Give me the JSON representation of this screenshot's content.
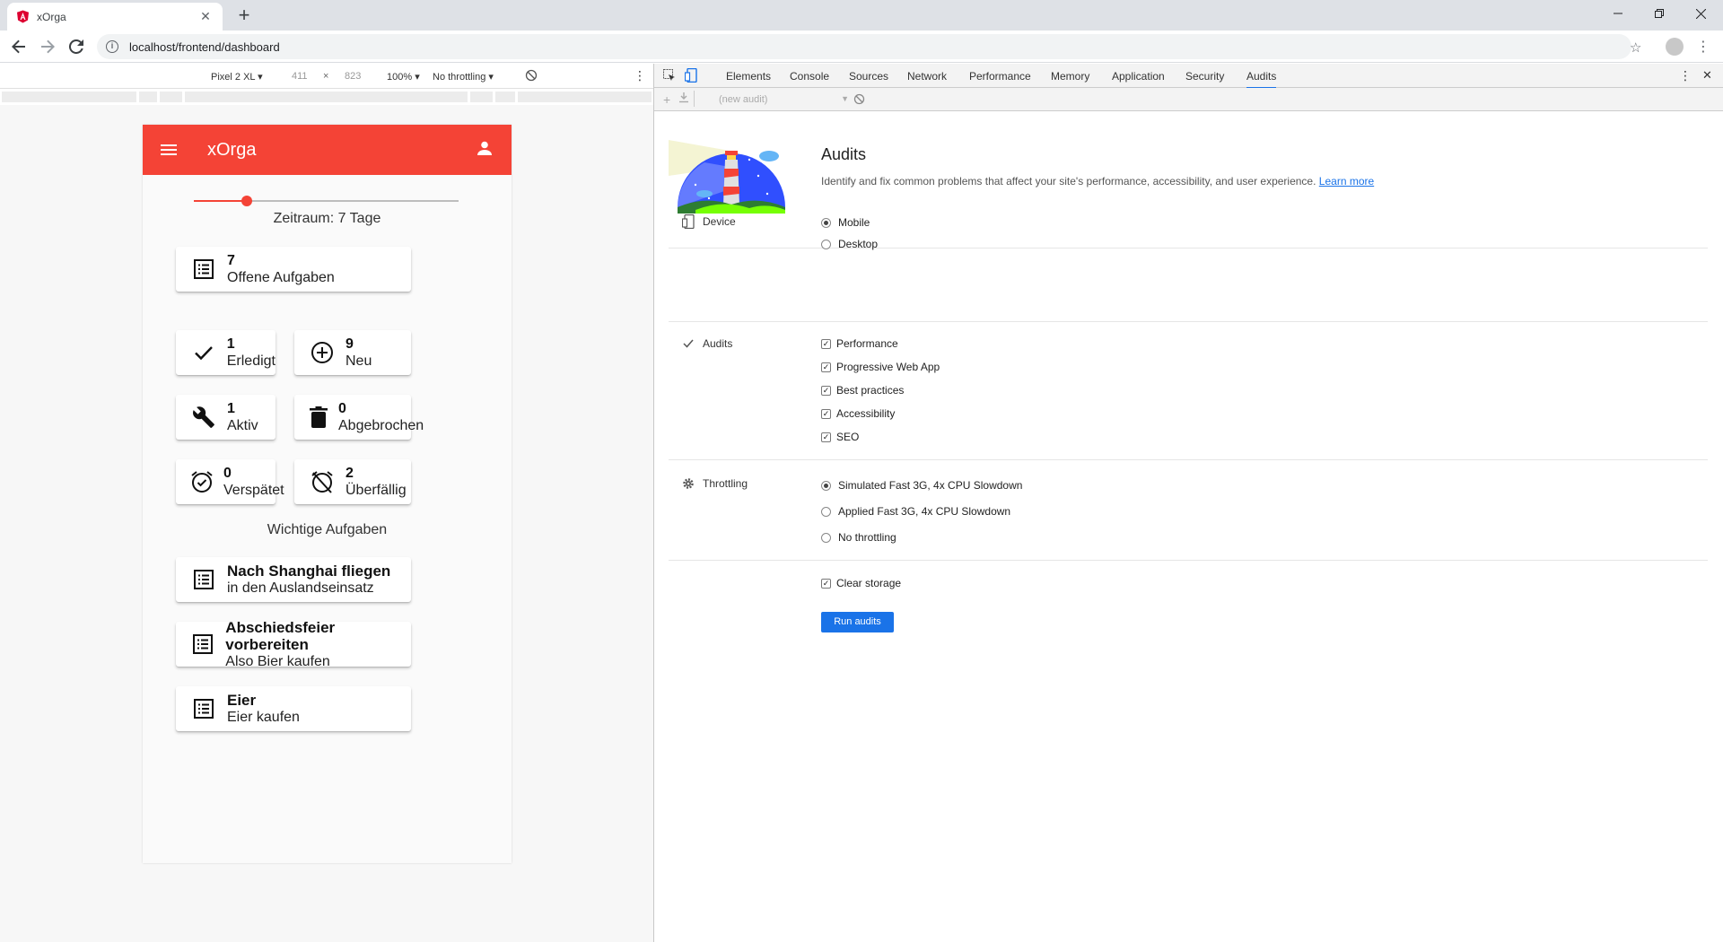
{
  "browser": {
    "tab_title": "xOrga",
    "url": "localhost/frontend/dashboard",
    "newtab_label": "+"
  },
  "device_toolbar": {
    "device": "Pixel 2 XL ▾",
    "width": "411",
    "times": "×",
    "height": "823",
    "zoom": "100% ▾",
    "throttling": "No throttling ▾"
  },
  "app": {
    "title": "xOrga",
    "slider": {
      "value_fraction": 0.2,
      "label": "Zeitraum: 7 Tage"
    },
    "open_tasks": {
      "count": "7",
      "label": "Offene Aufgaben"
    },
    "stats": [
      {
        "count": "1",
        "label": "Erledigt"
      },
      {
        "count": "9",
        "label": "Neu"
      },
      {
        "count": "1",
        "label": "Aktiv"
      },
      {
        "count": "0",
        "label": "Abgebrochen"
      },
      {
        "count": "0",
        "label": "Verspätet"
      },
      {
        "count": "2",
        "label": "Überfällig"
      }
    ],
    "important_title": "Wichtige Aufgaben",
    "important": [
      {
        "title": "Nach Shanghai fliegen",
        "subtitle": "in den Auslandseinsatz"
      },
      {
        "title": "Abschiedsfeier vorbereiten",
        "subtitle": "Also Bier kaufen"
      },
      {
        "title": "Eier",
        "subtitle": "Eier kaufen"
      }
    ]
  },
  "devtools": {
    "tabs": [
      "Elements",
      "Console",
      "Sources",
      "Network",
      "Performance",
      "Memory",
      "Application",
      "Security",
      "Audits"
    ],
    "active_tab": "Audits",
    "sub_select": "(new audit)",
    "audits": {
      "title": "Audits",
      "description": "Identify and fix common problems that affect your site's performance, accessibility, and user experience.",
      "learn_more": "Learn more",
      "device_label": "Device",
      "device_options": [
        "Mobile",
        "Desktop"
      ],
      "audits_label": "Audits",
      "audit_options": [
        "Performance",
        "Progressive Web App",
        "Best practices",
        "Accessibility",
        "SEO"
      ],
      "throttling_label": "Throttling",
      "throttling_options": [
        "Simulated Fast 3G, 4x CPU Slowdown",
        "Applied Fast 3G, 4x CPU Slowdown",
        "No throttling"
      ],
      "clear_storage": "Clear storage",
      "run_button": "Run audits"
    }
  },
  "colors": {
    "app_bar": "#f44336",
    "accent": "#1a73e8"
  }
}
